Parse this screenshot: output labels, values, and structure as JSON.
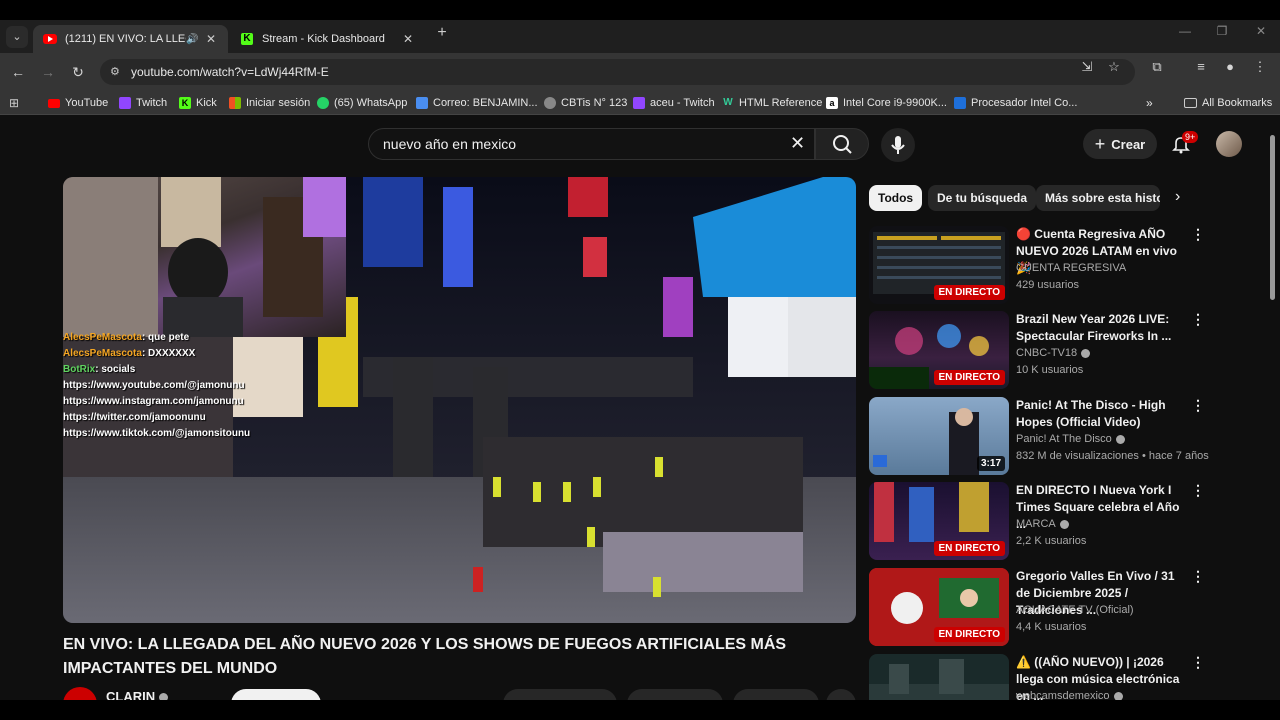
{
  "browser": {
    "tabs": [
      {
        "title": "(1211) EN VIVO: LA LLEGADA DEL AÑO NUEVO 2026",
        "active": true
      },
      {
        "title": "Stream - Kick Dashboard",
        "active": false
      }
    ],
    "url": "youtube.com/watch?v=LdWj44RfM-E",
    "bookmarks": [
      "YouTube",
      "Twitch",
      "Kick",
      "Iniciar sesión",
      "(65) WhatsApp",
      "Correo: BENJAMIN...",
      "CBTis N° 123",
      "aceu - Twitch",
      "HTML Reference",
      "Intel Core i9-9900K...",
      "Procesador Intel Co..."
    ],
    "all_bookmarks": "All Bookmarks"
  },
  "youtube": {
    "search_query": "nuevo año en mexico",
    "create_label": "Crear",
    "notif_count": "9+",
    "chips": [
      "Todos",
      "De tu búsqueda",
      "Más sobre esta historia"
    ],
    "video": {
      "title": "EN VIVO: LA LLEGADA DEL AÑO NUEVO 2026 Y LOS SHOWS DE FUEGOS ARTIFICIALES MÁS IMPACTANTES DEL MUNDO",
      "channel": "CLARIN",
      "chat": [
        {
          "user": "AlecsPeMascota",
          "msg": ": que pete"
        },
        {
          "user": "AlecsPeMascota",
          "msg": ": DXXXXXX"
        },
        {
          "user": "BotRix",
          "msg": ": socials"
        },
        {
          "user": "",
          "msg": "https://www.youtube.com/@jamonunu"
        },
        {
          "user": "",
          "msg": "https://www.instagram.com/jamonunu"
        },
        {
          "user": "",
          "msg": "https://twitter.com/jamoonunu"
        },
        {
          "user": "",
          "msg": "https://www.tiktok.com/@jamonsitounu"
        }
      ]
    },
    "recommendations": [
      {
        "title": "🔴 Cuenta Regresiva AÑO NUEVO 2026 LATAM en vivo 🎉",
        "channel": "CUENTA REGRESIVA",
        "views": "429 usuarios",
        "badge": "EN DIRECTO",
        "verified": false
      },
      {
        "title": "Brazil New Year 2026 LIVE: Spectacular Fireworks In ...",
        "channel": "CNBC-TV18",
        "views": "10 K usuarios",
        "badge": "EN DIRECTO",
        "verified": true
      },
      {
        "title": "Panic! At The Disco - High Hopes (Official Video)",
        "channel": "Panic! At The Disco",
        "views": "832 M de visualizaciones • hace 7 años",
        "badge": "3:17",
        "verified": true
      },
      {
        "title": "EN DIRECTO I Nueva York I Times Square celebra el Año ...",
        "channel": "MARCA",
        "views": "2,2 K usuarios",
        "badge": "EN DIRECTO",
        "verified": true
      },
      {
        "title": "Gregorio Valles En Vivo / 31 de Diciembre 2025 / Tradiciones ...",
        "channel": "AGUACATE TV (Oficial)",
        "views": "4,4 K usuarios",
        "badge": "EN DIRECTO",
        "verified": false
      },
      {
        "title": "⚠️ ((AÑO NUEVO)) | ¡2026 llega con música electrónica en ...",
        "channel": "webcamsdemexico",
        "views": "",
        "badge": "",
        "verified": true
      }
    ]
  }
}
